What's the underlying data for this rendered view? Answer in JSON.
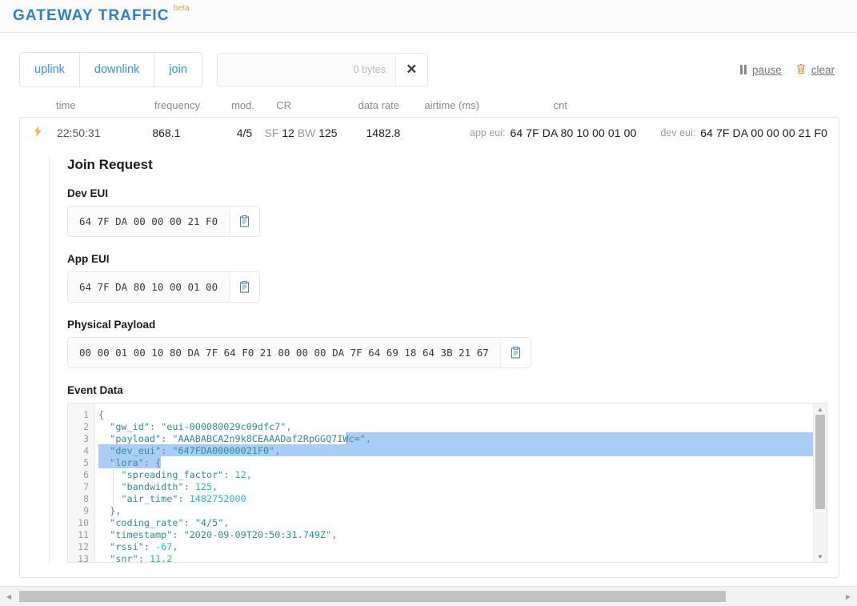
{
  "header": {
    "brand": "GATEWAY TRAFFIC",
    "beta": "beta"
  },
  "toolbar": {
    "buttons": [
      {
        "label": "uplink",
        "name": "uplink"
      },
      {
        "label": "downlink",
        "name": "downlink"
      },
      {
        "label": "join",
        "name": "join"
      }
    ],
    "filter_value": "",
    "filter_placeholder": "",
    "bytes_label": "0 bytes",
    "close_label": "✕",
    "pause_label": "pause",
    "clear_label": "clear"
  },
  "table": {
    "columns": {
      "time": "time",
      "frequency": "frequency",
      "mod": "mod.",
      "cr": "CR",
      "data_rate": "data rate",
      "airtime": "airtime (ms)",
      "cnt": "cnt"
    },
    "row": {
      "time": "22:50:31",
      "frequency": "868.1",
      "mod": "",
      "cr": "4/5",
      "sf_label": "SF",
      "sf_value": "12",
      "bw_label": "BW",
      "bw_value": "125",
      "airtime": "1482.8",
      "cnt": "",
      "app_eui_label": "app eui:",
      "app_eui_value": "64 7F DA 80 10 00 01 00",
      "dev_eui_label": "dev eui:",
      "dev_eui_value": "64 7F DA 00 00 00 21 F0"
    }
  },
  "detail": {
    "title": "Join Request",
    "dev_eui_label": "Dev EUI",
    "dev_eui_value": "64 7F DA 00 00 00 21 F0",
    "app_eui_label": "App EUI",
    "app_eui_value": "64 7F DA 80 10 00 01 00",
    "payload_label": "Physical Payload",
    "payload_value": "00 00 01 00 10 80 DA 7F 64 F0 21 00 00 00 DA 7F 64 69 18 64 3B 21 67",
    "event_data_label": "Event Data"
  },
  "event_json": {
    "lines": [
      {
        "no": "1",
        "text": "{"
      },
      {
        "no": "2",
        "text": "  \"gw_id\": \"eui-000080029c09dfc7\","
      },
      {
        "no": "3",
        "text": "  \"payload\": \"AAABABCA2n9k8CEAAADaf2RpGGQ7IWc=\","
      },
      {
        "no": "4",
        "text": "  \"dev_eui\": \"647FDA00000021F0\","
      },
      {
        "no": "5",
        "text": "  \"lora\": {"
      },
      {
        "no": "6",
        "text": "    \"spreading_factor\": 12,"
      },
      {
        "no": "7",
        "text": "    \"bandwidth\": 125,"
      },
      {
        "no": "8",
        "text": "    \"air_time\": 1482752000"
      },
      {
        "no": "9",
        "text": "  },"
      },
      {
        "no": "10",
        "text": "  \"coding_rate\": \"4/5\","
      },
      {
        "no": "11",
        "text": "  \"timestamp\": \"2020-09-09T20:50:31.749Z\","
      },
      {
        "no": "12",
        "text": "  \"rssi\": -67,"
      },
      {
        "no": "13",
        "text": "  \"snr\": 11.2"
      }
    ]
  },
  "colors": {
    "brand": "#2a7fd4",
    "beta": "#e0a23c",
    "bolt": "#f5b33c",
    "selection": "#aacdf5",
    "json_string": "#2f8f8f",
    "json_number": "#29b6c6"
  },
  "icons": {
    "bolt": "⚡",
    "copy": "clipboard-icon",
    "trash": "🗑",
    "arrow_up": "▲",
    "arrow_down": "▼",
    "arrow_left": "◀",
    "arrow_right": "▶"
  }
}
